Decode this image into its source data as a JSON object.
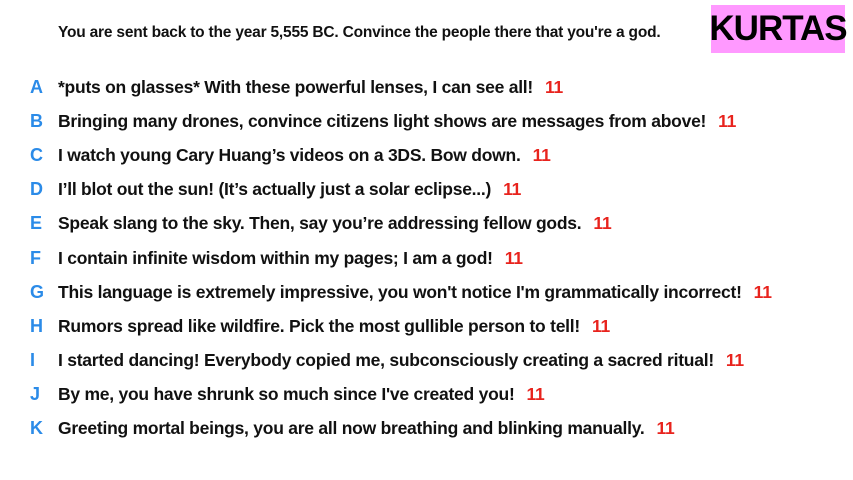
{
  "header": {
    "prompt": "You are sent back to the year 5,555 BC. Convince the people there that you're a god.",
    "player_name": "KURTAS",
    "badge_color": "#ff99ff"
  },
  "colors": {
    "letter": "#2b8be8",
    "score": "#e8231d",
    "text": "#111111"
  },
  "entries": [
    {
      "letter": "A",
      "text": "*puts on glasses* With these powerful lenses, I can see all!",
      "score": "11"
    },
    {
      "letter": "B",
      "text": "Bringing many drones, convince citizens light shows are messages from above!",
      "score": "11"
    },
    {
      "letter": "C",
      "text": "I watch young Cary Huang’s videos on a 3DS. Bow down.",
      "score": "11"
    },
    {
      "letter": "D",
      "text": "I’ll blot out the sun! (It’s actually just a solar eclipse...)",
      "score": "11"
    },
    {
      "letter": "E",
      "text": "Speak slang to the sky. Then, say you’re addressing fellow gods.",
      "score": "11"
    },
    {
      "letter": "F",
      "text": "I contain infinite wisdom within my pages; I am a god!",
      "score": "11"
    },
    {
      "letter": "G",
      "text": "This language is extremely impressive, you won't notice I'm grammatically incorrect!",
      "score": "11"
    },
    {
      "letter": "H",
      "text": "Rumors spread like wildfire. Pick the most gullible person to tell!",
      "score": "11"
    },
    {
      "letter": "I",
      "text": "I started dancing! Everybody copied me, subconsciously creating a sacred ritual!",
      "score": "11"
    },
    {
      "letter": "J",
      "text": "By me, you have shrunk so much since I've created you!",
      "score": "11"
    },
    {
      "letter": "K",
      "text": "Greeting mortal beings, you are all now breathing and blinking manually.",
      "score": "11"
    }
  ]
}
